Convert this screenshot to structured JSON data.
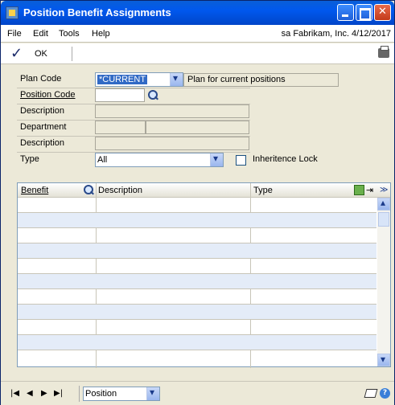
{
  "window": {
    "title": "Position Benefit Assignments"
  },
  "menu": {
    "items": [
      "File",
      "Edit",
      "Tools",
      "Help"
    ],
    "company": "sa  Fabrikam, Inc.  4/12/2017"
  },
  "toolbar": {
    "ok_label": "OK"
  },
  "form": {
    "plan_code_label": "Plan Code",
    "plan_code_value": "*CURRENT",
    "plan_desc": "Plan for current positions",
    "position_code_label": "Position Code",
    "position_code_value": "",
    "description_label": "Description",
    "department_label": "Department",
    "description2_label": "Description",
    "type_label": "Type",
    "type_value": "All",
    "inheritence_lock_label": "Inheritence Lock"
  },
  "grid": {
    "columns": [
      "Benefit",
      "Description",
      "Type"
    ],
    "rows": 10
  },
  "statusbar": {
    "sort_value": "Position"
  },
  "colors": {
    "title_bar": "#0058ee",
    "selection": "#316ac5",
    "row_alt": "#e4ecf8"
  }
}
